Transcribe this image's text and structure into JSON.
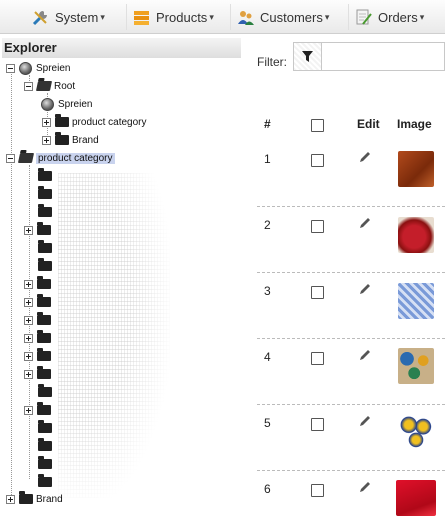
{
  "menu": {
    "items": [
      {
        "label": "System",
        "icon": "tools-icon"
      },
      {
        "label": "Products",
        "icon": "products-icon"
      },
      {
        "label": "Customers",
        "icon": "customers-icon"
      },
      {
        "label": "Orders",
        "icon": "orders-icon"
      }
    ],
    "caret": "▾"
  },
  "explorer": {
    "title": "Explorer",
    "tree": {
      "spreien": "Spreien",
      "root": "Root",
      "spreien_child": "Spreien",
      "product_category_child": "product category",
      "brand_child": "Brand",
      "product_category": "product category",
      "brand": "Brand"
    }
  },
  "filter": {
    "label": "Filter:",
    "value": ""
  },
  "table": {
    "headers": {
      "number": "#",
      "edit": "Edit",
      "image": "Image"
    },
    "rows": [
      {
        "number": "1",
        "image_desc": "brown fabric"
      },
      {
        "number": "2",
        "image_desc": "red pillow"
      },
      {
        "number": "3",
        "image_desc": "blue checked cloth"
      },
      {
        "number": "4",
        "image_desc": "painted balls"
      },
      {
        "number": "5",
        "image_desc": "blue yellow plates"
      },
      {
        "number": "6",
        "image_desc": "red cloth"
      }
    ]
  },
  "colors": {
    "selection": "#c9d3ee",
    "menu_bg": "#efefef"
  }
}
